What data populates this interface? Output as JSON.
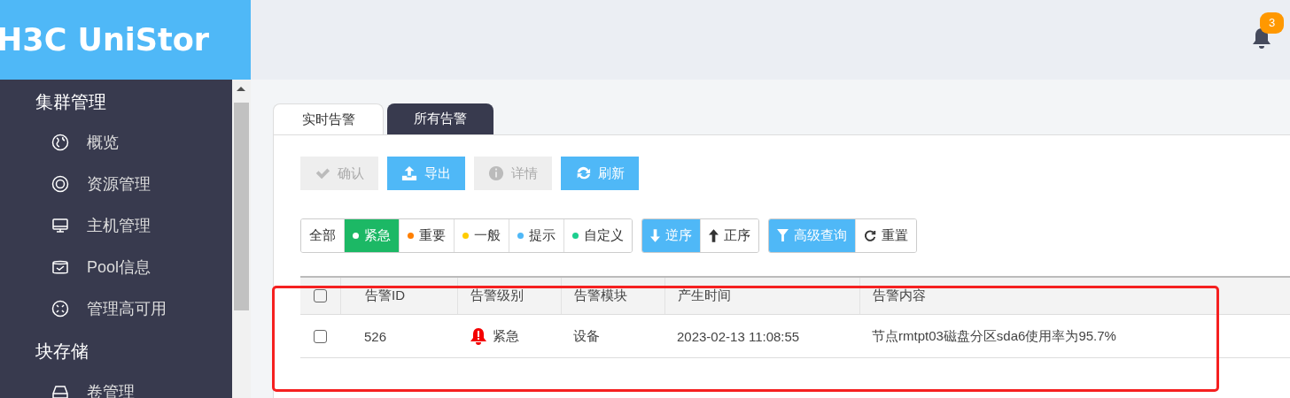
{
  "logo": "H3C UniStor",
  "notifications": {
    "count": "3"
  },
  "sidebar": {
    "groups": [
      {
        "title": "集群管理",
        "items": [
          {
            "label": "概览"
          },
          {
            "label": "资源管理"
          },
          {
            "label": "主机管理"
          },
          {
            "label": "Pool信息"
          },
          {
            "label": "管理高可用"
          }
        ]
      },
      {
        "title": "块存储",
        "items": [
          {
            "label": "卷管理"
          }
        ]
      }
    ]
  },
  "tabs": [
    {
      "label": "实时告警",
      "selected": true
    },
    {
      "label": "所有告警",
      "selected": false
    }
  ],
  "actions": [
    {
      "label": "确认",
      "disabled": true
    },
    {
      "label": "导出",
      "disabled": false
    },
    {
      "label": "详情",
      "disabled": true
    },
    {
      "label": "刷新",
      "disabled": false
    }
  ],
  "filters": [
    {
      "label": "全部",
      "selected": false
    },
    {
      "label": "紧急",
      "selected": true,
      "color": "#ffffff"
    },
    {
      "label": "重要",
      "selected": false,
      "color": "#ff7f00"
    },
    {
      "label": "一般",
      "selected": false,
      "color": "#ffcc00"
    },
    {
      "label": "提示",
      "selected": false,
      "color": "#4fb8f7"
    },
    {
      "label": "自定义",
      "selected": false,
      "color": "#1ccf8f"
    }
  ],
  "sort": [
    {
      "label": "逆序",
      "selected": true
    },
    {
      "label": "正序",
      "selected": false
    }
  ],
  "query": [
    {
      "label": "高级查询",
      "kind": "primary"
    },
    {
      "label": "重置",
      "kind": "default"
    }
  ],
  "table": {
    "all_checked": false,
    "columns": [
      "告警ID",
      "告警级别",
      "告警模块",
      "产生时间",
      "告警内容"
    ],
    "rows": [
      {
        "checked": false,
        "id": "526",
        "severity": "紧急",
        "module": "设备",
        "time": "2023-02-13 11:08:55",
        "content": "节点rmtpt03磁盘分区sda6使用率为95.7%"
      }
    ]
  }
}
